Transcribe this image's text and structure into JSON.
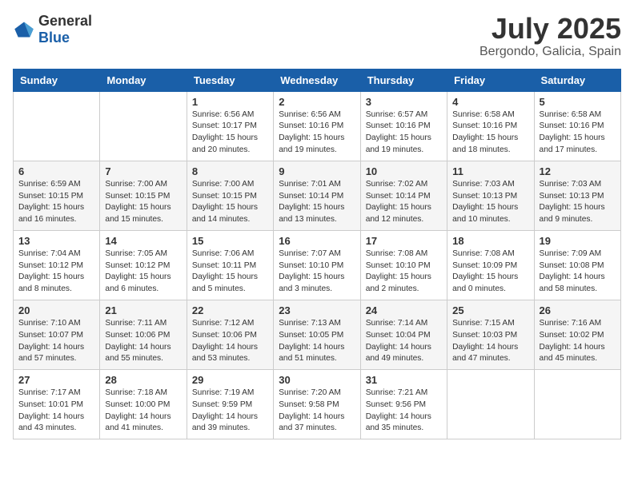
{
  "logo": {
    "general": "General",
    "blue": "Blue"
  },
  "header": {
    "month": "July 2025",
    "location": "Bergondo, Galicia, Spain"
  },
  "weekdays": [
    "Sunday",
    "Monday",
    "Tuesday",
    "Wednesday",
    "Thursday",
    "Friday",
    "Saturday"
  ],
  "weeks": [
    [
      {
        "day": "",
        "info": ""
      },
      {
        "day": "",
        "info": ""
      },
      {
        "day": "1",
        "info": "Sunrise: 6:56 AM\nSunset: 10:17 PM\nDaylight: 15 hours and 20 minutes."
      },
      {
        "day": "2",
        "info": "Sunrise: 6:56 AM\nSunset: 10:16 PM\nDaylight: 15 hours and 19 minutes."
      },
      {
        "day": "3",
        "info": "Sunrise: 6:57 AM\nSunset: 10:16 PM\nDaylight: 15 hours and 19 minutes."
      },
      {
        "day": "4",
        "info": "Sunrise: 6:58 AM\nSunset: 10:16 PM\nDaylight: 15 hours and 18 minutes."
      },
      {
        "day": "5",
        "info": "Sunrise: 6:58 AM\nSunset: 10:16 PM\nDaylight: 15 hours and 17 minutes."
      }
    ],
    [
      {
        "day": "6",
        "info": "Sunrise: 6:59 AM\nSunset: 10:15 PM\nDaylight: 15 hours and 16 minutes."
      },
      {
        "day": "7",
        "info": "Sunrise: 7:00 AM\nSunset: 10:15 PM\nDaylight: 15 hours and 15 minutes."
      },
      {
        "day": "8",
        "info": "Sunrise: 7:00 AM\nSunset: 10:15 PM\nDaylight: 15 hours and 14 minutes."
      },
      {
        "day": "9",
        "info": "Sunrise: 7:01 AM\nSunset: 10:14 PM\nDaylight: 15 hours and 13 minutes."
      },
      {
        "day": "10",
        "info": "Sunrise: 7:02 AM\nSunset: 10:14 PM\nDaylight: 15 hours and 12 minutes."
      },
      {
        "day": "11",
        "info": "Sunrise: 7:03 AM\nSunset: 10:13 PM\nDaylight: 15 hours and 10 minutes."
      },
      {
        "day": "12",
        "info": "Sunrise: 7:03 AM\nSunset: 10:13 PM\nDaylight: 15 hours and 9 minutes."
      }
    ],
    [
      {
        "day": "13",
        "info": "Sunrise: 7:04 AM\nSunset: 10:12 PM\nDaylight: 15 hours and 8 minutes."
      },
      {
        "day": "14",
        "info": "Sunrise: 7:05 AM\nSunset: 10:12 PM\nDaylight: 15 hours and 6 minutes."
      },
      {
        "day": "15",
        "info": "Sunrise: 7:06 AM\nSunset: 10:11 PM\nDaylight: 15 hours and 5 minutes."
      },
      {
        "day": "16",
        "info": "Sunrise: 7:07 AM\nSunset: 10:10 PM\nDaylight: 15 hours and 3 minutes."
      },
      {
        "day": "17",
        "info": "Sunrise: 7:08 AM\nSunset: 10:10 PM\nDaylight: 15 hours and 2 minutes."
      },
      {
        "day": "18",
        "info": "Sunrise: 7:08 AM\nSunset: 10:09 PM\nDaylight: 15 hours and 0 minutes."
      },
      {
        "day": "19",
        "info": "Sunrise: 7:09 AM\nSunset: 10:08 PM\nDaylight: 14 hours and 58 minutes."
      }
    ],
    [
      {
        "day": "20",
        "info": "Sunrise: 7:10 AM\nSunset: 10:07 PM\nDaylight: 14 hours and 57 minutes."
      },
      {
        "day": "21",
        "info": "Sunrise: 7:11 AM\nSunset: 10:06 PM\nDaylight: 14 hours and 55 minutes."
      },
      {
        "day": "22",
        "info": "Sunrise: 7:12 AM\nSunset: 10:06 PM\nDaylight: 14 hours and 53 minutes."
      },
      {
        "day": "23",
        "info": "Sunrise: 7:13 AM\nSunset: 10:05 PM\nDaylight: 14 hours and 51 minutes."
      },
      {
        "day": "24",
        "info": "Sunrise: 7:14 AM\nSunset: 10:04 PM\nDaylight: 14 hours and 49 minutes."
      },
      {
        "day": "25",
        "info": "Sunrise: 7:15 AM\nSunset: 10:03 PM\nDaylight: 14 hours and 47 minutes."
      },
      {
        "day": "26",
        "info": "Sunrise: 7:16 AM\nSunset: 10:02 PM\nDaylight: 14 hours and 45 minutes."
      }
    ],
    [
      {
        "day": "27",
        "info": "Sunrise: 7:17 AM\nSunset: 10:01 PM\nDaylight: 14 hours and 43 minutes."
      },
      {
        "day": "28",
        "info": "Sunrise: 7:18 AM\nSunset: 10:00 PM\nDaylight: 14 hours and 41 minutes."
      },
      {
        "day": "29",
        "info": "Sunrise: 7:19 AM\nSunset: 9:59 PM\nDaylight: 14 hours and 39 minutes."
      },
      {
        "day": "30",
        "info": "Sunrise: 7:20 AM\nSunset: 9:58 PM\nDaylight: 14 hours and 37 minutes."
      },
      {
        "day": "31",
        "info": "Sunrise: 7:21 AM\nSunset: 9:56 PM\nDaylight: 14 hours and 35 minutes."
      },
      {
        "day": "",
        "info": ""
      },
      {
        "day": "",
        "info": ""
      }
    ]
  ]
}
